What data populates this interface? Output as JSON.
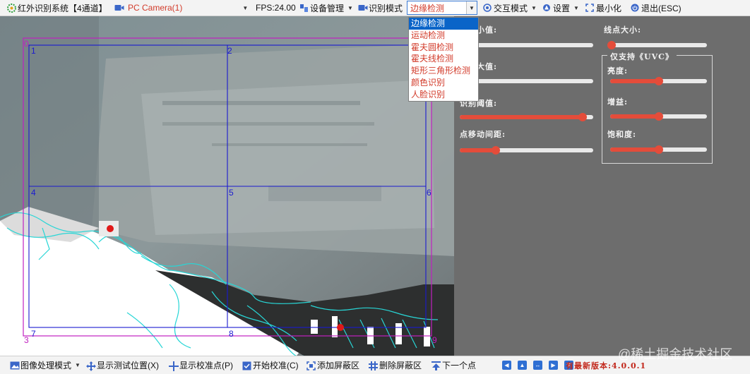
{
  "toolbar": {
    "app_title": "红外识别系统【4通道】",
    "camera": "PC Camera(1)",
    "fps": "FPS:24.00",
    "device_mgmt": "设备管理",
    "recog_mode": "识别模式",
    "mode_selected": "边缘检测",
    "interact_mode": "交互模式",
    "settings": "设置",
    "minimize": "最小化",
    "exit": "退出(ESC)"
  },
  "mode_dropdown": {
    "options": [
      "边缘检测",
      "运动检测",
      "霍夫圆检测",
      "霍夫线检测",
      "矩形三角形检测",
      "颜色识别",
      "人脸识别"
    ],
    "selected_index": 0
  },
  "grid_labels": [
    "0",
    "1",
    "2",
    "3",
    "4",
    "5",
    "6",
    "7",
    "8",
    "9"
  ],
  "panel": {
    "point_min": "点最小值:",
    "point_max": "点最大值:",
    "recog_thresh": "识别阈值:",
    "move_dist": "点移动间距:",
    "line_size": "线点大小:",
    "uvc_title": "仅支持《UVC》",
    "brightness": "亮度:",
    "gain": "增益:",
    "saturation": "饱和度:"
  },
  "slider_values": {
    "point_min": 0.0,
    "point_max": 0.0,
    "recog_thresh": 0.92,
    "move_dist": 0.27,
    "line_size": 0.0,
    "brightness": 0.5,
    "gain": 0.5,
    "saturation": 0.5
  },
  "statusbar": {
    "image_mode": "图像处理模式",
    "show_test_pos": "显示测试位置(X)",
    "show_calib": "显示校准点(P)",
    "start_calib": "开始校准(C)",
    "add_mask": "添加屏蔽区",
    "remove_mask": "删除屏蔽区",
    "next_point": "下一个点",
    "new_version": "有最新版本:4.0.0.1"
  },
  "watermark": "@稀土掘金技术社区",
  "colors": {
    "accent_red": "#e44c3a",
    "panel_bg": "#6d6d6d",
    "grid_blue": "#1a1ad0",
    "grid_magenta": "#c020c0",
    "selection_blue": "#0a64c8"
  }
}
